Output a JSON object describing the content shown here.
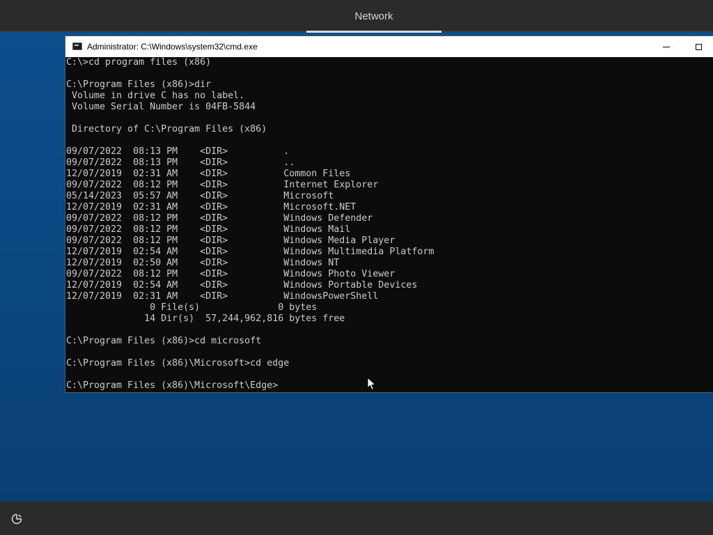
{
  "top_bar": {
    "tab_label": "Network"
  },
  "cmd_window": {
    "title": "Administrator: C:\\Windows\\system32\\cmd.exe",
    "console_lines": [
      "C:\\>cd program files (x86)",
      "",
      "C:\\Program Files (x86)>dir",
      " Volume in drive C has no label.",
      " Volume Serial Number is 04FB-5844",
      "",
      " Directory of C:\\Program Files (x86)",
      "",
      "09/07/2022  08:13 PM    <DIR>          .",
      "09/07/2022  08:13 PM    <DIR>          ..",
      "12/07/2019  02:31 AM    <DIR>          Common Files",
      "09/07/2022  08:12 PM    <DIR>          Internet Explorer",
      "05/14/2023  05:57 AM    <DIR>          Microsoft",
      "12/07/2019  02:31 AM    <DIR>          Microsoft.NET",
      "09/07/2022  08:12 PM    <DIR>          Windows Defender",
      "09/07/2022  08:12 PM    <DIR>          Windows Mail",
      "09/07/2022  08:12 PM    <DIR>          Windows Media Player",
      "12/07/2019  02:54 AM    <DIR>          Windows Multimedia Platform",
      "12/07/2019  02:50 AM    <DIR>          Windows NT",
      "09/07/2022  08:12 PM    <DIR>          Windows Photo Viewer",
      "12/07/2019  02:54 AM    <DIR>          Windows Portable Devices",
      "12/07/2019  02:31 AM    <DIR>          WindowsPowerShell",
      "               0 File(s)              0 bytes",
      "              14 Dir(s)  57,244,962,816 bytes free",
      "",
      "C:\\Program Files (x86)>cd microsoft",
      "",
      "C:\\Program Files (x86)\\Microsoft>cd edge",
      "",
      "C:\\Program Files (x86)\\Microsoft\\Edge>"
    ]
  },
  "icons": {
    "window_icon": "cmd-icon",
    "minimize": "minimize-icon",
    "maximize": "maximize-icon",
    "cursor": "mouse-pointer-icon",
    "accessibility": "accessibility-icon"
  },
  "colors": {
    "desktop_blue": "#0b4a86",
    "bar_dark": "#2b2b2b",
    "console_bg": "#0c0c0c",
    "console_text": "#cccccc"
  }
}
